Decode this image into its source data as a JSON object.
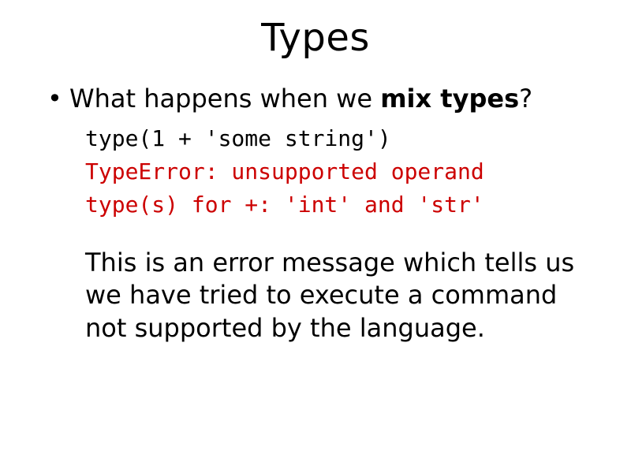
{
  "title": "Types",
  "bullet": {
    "pre": "What happens when we ",
    "bold": "mix types",
    "post": "?"
  },
  "code_line": "type(1 + 'some string')",
  "error_line1": "TypeError: unsupported operand",
  "error_line2": "type(s) for +: 'int' and 'str'",
  "explanation": "This is an error message which tells us we have tried to execute a command not supported by the language."
}
